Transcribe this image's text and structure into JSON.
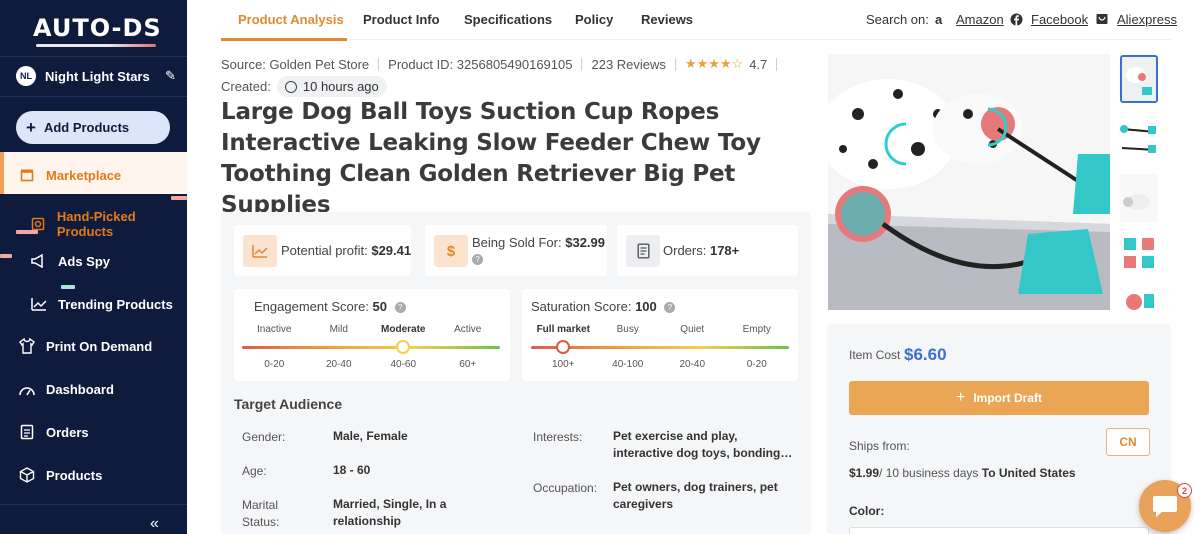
{
  "sidebar": {
    "logo": "AUTO-DS",
    "store_initials": "NL",
    "store_name": "Night Light Stars",
    "add_products": "Add Products",
    "items": [
      {
        "label": "Marketplace"
      },
      {
        "label": "Hand-Picked Products"
      },
      {
        "label": "Ads Spy"
      },
      {
        "label": "Trending Products"
      },
      {
        "label": "Print On Demand"
      },
      {
        "label": "Dashboard"
      },
      {
        "label": "Orders"
      },
      {
        "label": "Products"
      }
    ]
  },
  "tabs": [
    "Product Analysis",
    "Product Info",
    "Specifications",
    "Policy",
    "Reviews"
  ],
  "search_on": {
    "label": "Search on:",
    "links": [
      "Amazon",
      "Facebook",
      "Aliexpress"
    ]
  },
  "product": {
    "source": "Source: Golden Pet Store",
    "product_id": "Product ID: 3256805490169105",
    "reviews": "223 Reviews",
    "rating": "4.7",
    "stars": "★★★★☆",
    "created_label": "Created:",
    "created_value": "10 hours ago",
    "title": "Large Dog Ball Toys Suction Cup Ropes Interactive Leaking Slow Feeder Chew Toy Toothing Clean Golden Retriever Big Pet Supplies"
  },
  "stats": {
    "profit_label": "Potential profit:",
    "profit_value": "$29.41",
    "sold_label": "Being Sold For:",
    "sold_value": "$32.99",
    "orders_label": "Orders:",
    "orders_value": "178+"
  },
  "engagement": {
    "label": "Engagement Score:",
    "value": "50",
    "level_fraction": 0.625,
    "levels": [
      "Inactive",
      "Mild",
      "Moderate",
      "Active"
    ],
    "ranges": [
      "0-20",
      "20-40",
      "40-60",
      "60+"
    ],
    "colors": [
      "#e0584a",
      "#e9a23b",
      "#f2d04b",
      "#6cc04a"
    ]
  },
  "saturation": {
    "label": "Saturation Score:",
    "value": "100",
    "level_fraction": 0.125,
    "levels": [
      "Full market",
      "Busy",
      "Quiet",
      "Empty"
    ],
    "ranges": [
      "100+",
      "40-100",
      "20-40",
      "0-20"
    ],
    "colors": [
      "#e0584a",
      "#e9a23b",
      "#f2d04b",
      "#6cc04a"
    ]
  },
  "target_audience": {
    "title": "Target Audience",
    "gender_label": "Gender:",
    "gender_value": "Male, Female",
    "age_label": "Age:",
    "age_value": "18 - 60",
    "marital_label_1": "Marital",
    "marital_label_2": "Status:",
    "marital_value_1": "Married, Single, In a",
    "marital_value_2": "relationship",
    "interests_label": "Interests:",
    "interests_value_1": "Pet exercise and play,",
    "interests_value_2": "interactive dog toys, bonding…",
    "occupation_label": "Occupation:",
    "occupation_value_1": "Pet owners, dog trainers, pet",
    "occupation_value_2": "caregivers"
  },
  "pricing": {
    "item_cost_label": "Item Cost",
    "item_cost_value": "$6.60",
    "import_label": "Import Draft",
    "ships_from_label": "Ships from:",
    "ships_from_value": "CN",
    "shipping_cost": "$1.99",
    "shipping_days": "/ 10 business days",
    "shipping_to": "To United States",
    "color_label": "Color:"
  },
  "chat_badge": "2",
  "colors": {
    "sidebar_bg": "#0f1b3d",
    "accent_orange": "#e08a30",
    "accent_blue": "#3b6fd1"
  }
}
